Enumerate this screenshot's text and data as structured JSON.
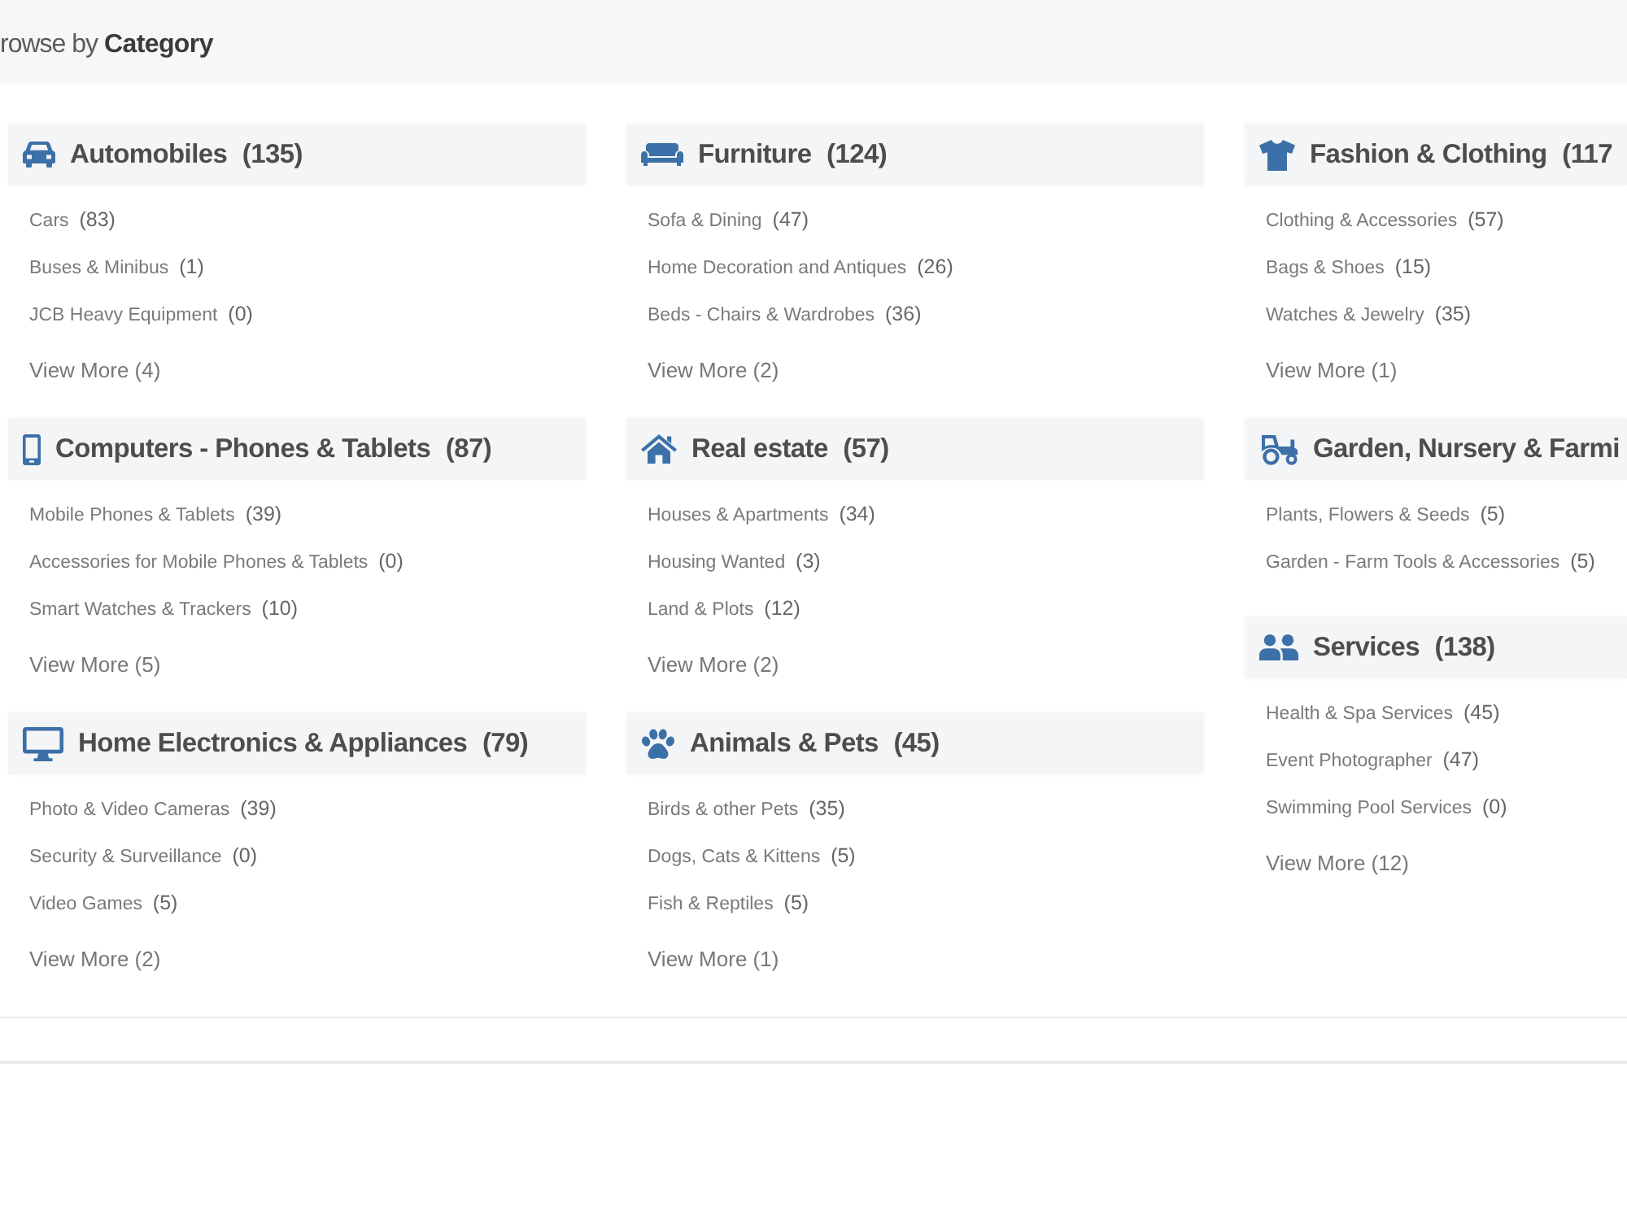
{
  "header": {
    "title": "rowse by **Category**"
  },
  "columns": [
    {
      "categories": [
        {
          "kind": "car",
          "name": "Automobiles",
          "count": "(135)",
          "items": [
            {
              "name": "Cars",
              "count": "(83)"
            },
            {
              "name": "Buses & Minibus",
              "count": "(1)"
            },
            {
              "name": "JCB Heavy Equipment",
              "count": "(0)"
            }
          ],
          "view_more": "View More (4)"
        },
        {
          "kind": "phone",
          "name": "Computers - Phones & Tablets",
          "count": "(87)",
          "items": [
            {
              "name": "Mobile Phones & Tablets",
              "count": "(39)"
            },
            {
              "name": "Accessories for Mobile Phones & Tablets",
              "count": "(0)"
            },
            {
              "name": "Smart Watches & Trackers",
              "count": "(10)"
            }
          ],
          "view_more": "View More (5)"
        },
        {
          "kind": "monitor",
          "name": "Home Electronics & Appliances",
          "count": "(79)",
          "items": [
            {
              "name": "Photo & Video Cameras",
              "count": "(39)"
            },
            {
              "name": "Security & Surveillance",
              "count": "(0)"
            },
            {
              "name": "Video Games",
              "count": "(5)"
            }
          ],
          "view_more": "View More (2)"
        }
      ]
    },
    {
      "categories": [
        {
          "kind": "sofa",
          "name": "Furniture",
          "count": "(124)",
          "items": [
            {
              "name": "Sofa & Dining",
              "count": "(47)"
            },
            {
              "name": "Home Decoration and Antiques",
              "count": "(26)"
            },
            {
              "name": "Beds - Chairs & Wardrobes",
              "count": "(36)"
            }
          ],
          "view_more": "View More (2)"
        },
        {
          "kind": "house",
          "name": "Real estate",
          "count": "(57)",
          "items": [
            {
              "name": "Houses & Apartments",
              "count": "(34)"
            },
            {
              "name": "Housing Wanted",
              "count": "(3)"
            },
            {
              "name": "Land & Plots",
              "count": "(12)"
            }
          ],
          "view_more": "View More (2)"
        },
        {
          "kind": "paw",
          "name": "Animals & Pets",
          "count": "(45)",
          "items": [
            {
              "name": "Birds & other Pets",
              "count": "(35)"
            },
            {
              "name": "Dogs, Cats & Kittens",
              "count": "(5)"
            },
            {
              "name": "Fish & Reptiles",
              "count": "(5)"
            }
          ],
          "view_more": "View More (1)"
        }
      ]
    },
    {
      "categories": [
        {
          "kind": "tshirt",
          "name": "Fashion & Clothing",
          "count": "(117",
          "items": [
            {
              "name": "Clothing & Accessories",
              "count": "(57)"
            },
            {
              "name": "Bags & Shoes",
              "count": "(15)"
            },
            {
              "name": "Watches & Jewelry",
              "count": "(35)"
            }
          ],
          "view_more": "View More (1)"
        },
        {
          "kind": "tractor",
          "name": "Garden, Nursery & Farmi",
          "items": [
            {
              "name": "Plants, Flowers & Seeds",
              "count": "(5)"
            },
            {
              "name": "Garden - Farm Tools & Accessories",
              "count": "(5)"
            }
          ]
        },
        {
          "kind": "people",
          "name": "Services",
          "count": "(138)",
          "items": [
            {
              "name": "Health & Spa Services",
              "count": "(45)"
            },
            {
              "name": "Event Photographer",
              "count": "(47)"
            },
            {
              "name": "Swimming Pool Services",
              "count": "(0)"
            }
          ],
          "view_more": "View More (12)"
        }
      ]
    }
  ]
}
